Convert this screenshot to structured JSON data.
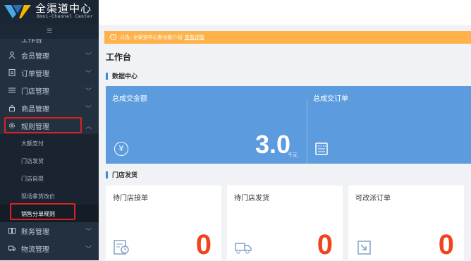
{
  "app": {
    "title": "全渠道中心",
    "subtitle": "Omni-Channel Center"
  },
  "sidebar": {
    "collapse_icon": "menu-fold-icon",
    "partial_item": "工作台",
    "items": [
      {
        "label": "会员管理",
        "icon": "member-icon",
        "chevron": "﹀"
      },
      {
        "label": "订单管理",
        "icon": "order-icon",
        "chevron": "﹀"
      },
      {
        "label": "门店管理",
        "icon": "list-icon",
        "chevron": "﹀"
      },
      {
        "label": "商品管理",
        "icon": "lock-icon",
        "chevron": "﹀"
      },
      {
        "label": "规则管理",
        "icon": "gear-icon",
        "chevron": "︿"
      },
      {
        "label": "账务管理",
        "icon": "book-icon",
        "chevron": "﹀"
      },
      {
        "label": "物流管理",
        "icon": "truck-icon",
        "chevron": "﹀"
      }
    ],
    "sub_items": [
      "大额支付",
      "门店发货",
      "门店自提",
      "现场拿货改价",
      "销售分单规则"
    ]
  },
  "notice": {
    "icon": "!",
    "text": "公告: 全渠道中心新功能介绍",
    "link": "查看详情"
  },
  "page": {
    "title": "工作台"
  },
  "sections": {
    "data_center": "数据中心",
    "store_delivery": "门店发货"
  },
  "stats": {
    "total_amount_label": "总成交金额",
    "total_amount_value": "3.0",
    "total_amount_unit": "千元",
    "total_orders_label": "总成交订单",
    "yen_symbol": "¥"
  },
  "cards": [
    {
      "label": "待门店接单",
      "value": "0",
      "icon": "clock-doc-icon"
    },
    {
      "label": "待门店发货",
      "value": "0",
      "icon": "delivery-truck-icon"
    },
    {
      "label": "可改派订单",
      "value": "0",
      "icon": "transfer-icon"
    }
  ],
  "colors": {
    "sidebar": "#22303f",
    "accent_blue": "#5b9bde",
    "notice": "#ffb24a",
    "highlight": "#e02020",
    "number": "#f0441e"
  }
}
